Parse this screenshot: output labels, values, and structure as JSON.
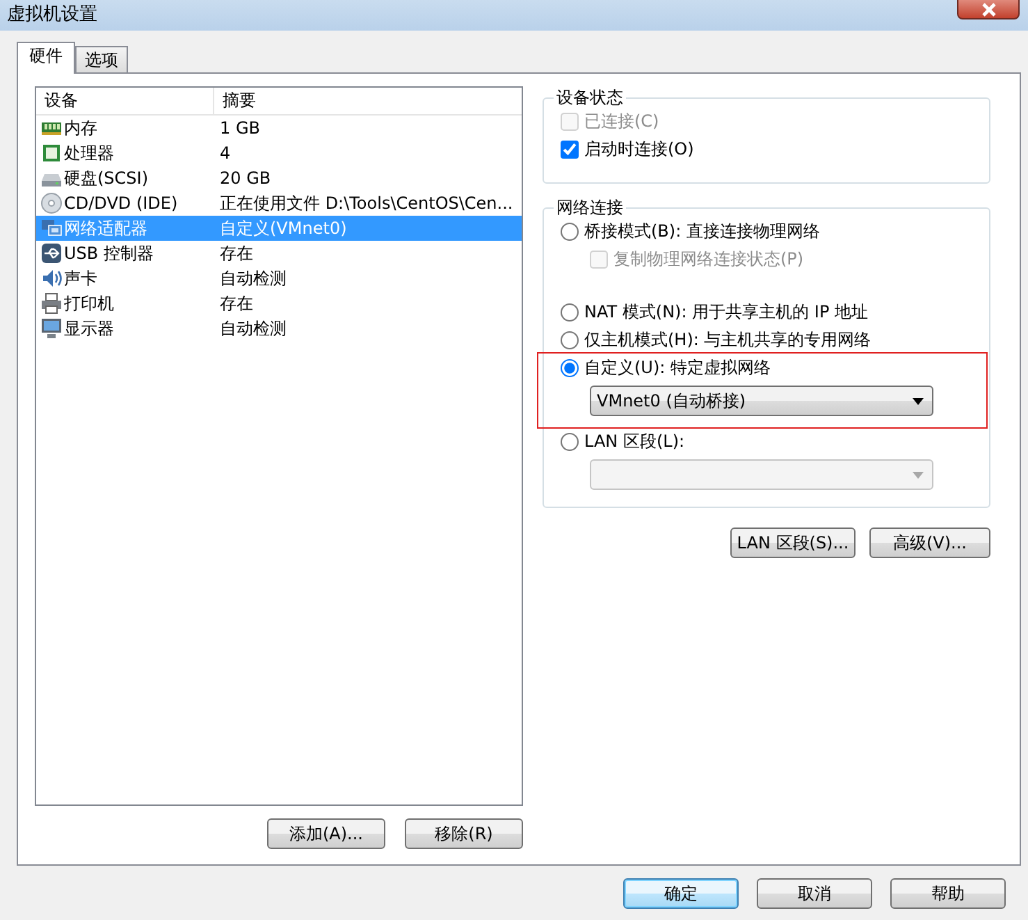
{
  "window": {
    "title": "虚拟机设置"
  },
  "tabs": [
    {
      "label": "硬件",
      "selected": true
    },
    {
      "label": "选项",
      "selected": false
    }
  ],
  "device_table": {
    "columns": [
      "设备",
      "摘要"
    ],
    "rows": [
      {
        "device": "内存",
        "summary": "1 GB",
        "selected": false
      },
      {
        "device": "处理器",
        "summary": "4",
        "selected": false
      },
      {
        "device": "硬盘(SCSI)",
        "summary": "20 GB",
        "selected": false
      },
      {
        "device": "CD/DVD (IDE)",
        "summary": "正在使用文件 D:\\Tools\\CentOS\\Cen...",
        "selected": false
      },
      {
        "device": "网络适配器",
        "summary": "自定义(VMnet0)",
        "selected": true
      },
      {
        "device": "USB 控制器",
        "summary": "存在",
        "selected": false
      },
      {
        "device": "声卡",
        "summary": "自动检测",
        "selected": false
      },
      {
        "device": "打印机",
        "summary": "存在",
        "selected": false
      },
      {
        "device": "显示器",
        "summary": "自动检测",
        "selected": false
      }
    ]
  },
  "device_buttons": [
    "添加(A)...",
    "移除(R)"
  ],
  "device_status": {
    "title": "设备状态",
    "options": [
      {
        "label": "已连接(C)",
        "checked": false,
        "disabled": true
      },
      {
        "label": "启动时连接(O)",
        "checked": true,
        "disabled": false
      }
    ]
  },
  "network_connection": {
    "title": "网络连接",
    "options": [
      {
        "kind": "radio",
        "label": "桥接模式(B): 直接连接物理网络",
        "selected": false
      },
      {
        "kind": "checkbox",
        "label": "复制物理网络连接状态(P)",
        "checked": false,
        "disabled": true
      },
      {
        "kind": "radio",
        "label": "NAT 模式(N): 用于共享主机的 IP 地址",
        "selected": false
      },
      {
        "kind": "radio",
        "label": "仅主机模式(H): 与主机共享的专用网络",
        "selected": false
      },
      {
        "kind": "radio",
        "label": "自定义(U): 特定虚拟网络",
        "selected": true,
        "highlighted": true,
        "dropdown": {
          "value": "VMnet0 (自动桥接)",
          "disabled": false
        }
      },
      {
        "kind": "radio",
        "label": "LAN 区段(L):",
        "selected": false,
        "dropdown": {
          "disabled": true
        }
      }
    ]
  },
  "network_buttons": [
    "LAN 区段(S)...",
    "高级(V)..."
  ],
  "dialog_buttons": [
    {
      "label": "确定",
      "default": true
    },
    {
      "label": "取消",
      "default": false
    },
    {
      "label": "帮助",
      "default": false
    }
  ]
}
